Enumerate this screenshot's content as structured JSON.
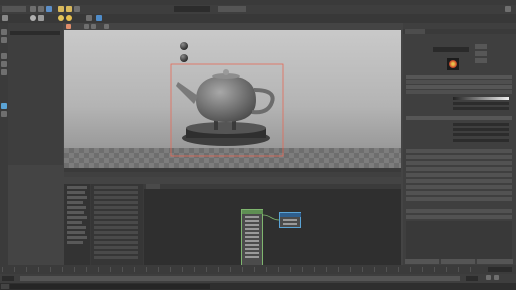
{
  "app": {
    "title": "",
    "accent": "#5ba4d6",
    "selection_color": "#e56a57"
  },
  "menubar": {
    "items": [
      "",
      "",
      "",
      "",
      "",
      "",
      "",
      "",
      "",
      "",
      "",
      ""
    ]
  },
  "status_line": {
    "mode_label": "",
    "render_label": "",
    "field_label": ""
  },
  "outliner": {
    "title": "",
    "search_placeholder": "",
    "items": [
      "",
      "",
      "",
      "",
      "",
      "",
      "",
      "",
      "",
      ""
    ]
  },
  "viewport": {
    "panel_menus": [
      "",
      "",
      "",
      "",
      "",
      ""
    ],
    "camera_label": ""
  },
  "hypershade": {
    "title": "",
    "menus": [
      "",
      "",
      "",
      "",
      "",
      "",
      "",
      ""
    ],
    "tabs": [
      "",
      "",
      "",
      ""
    ],
    "tree_items": [
      "",
      "",
      "",
      "",
      "",
      "",
      "",
      "",
      "",
      "",
      "",
      ""
    ],
    "list_items": [
      "",
      "",
      "",
      "",
      "",
      "",
      "",
      "",
      "",
      "",
      "",
      "",
      "",
      "",
      "",
      "",
      ""
    ],
    "node_a_title": "",
    "node_b_title": ""
  },
  "attribute_editor": {
    "title": "",
    "tabs": [
      "",
      "",
      "",
      ""
    ],
    "node_name_label": "",
    "node_name_value": "",
    "focus_button": "",
    "presets_button": "",
    "show_button": "",
    "hide_button": "",
    "sections": [
      "",
      "",
      "",
      "",
      "",
      "",
      "",
      "",
      "",
      "",
      "",
      ""
    ],
    "bottom_buttons": [
      "",
      "",
      ""
    ]
  },
  "timeline": {
    "start": "",
    "end": "",
    "current_frame": ""
  }
}
